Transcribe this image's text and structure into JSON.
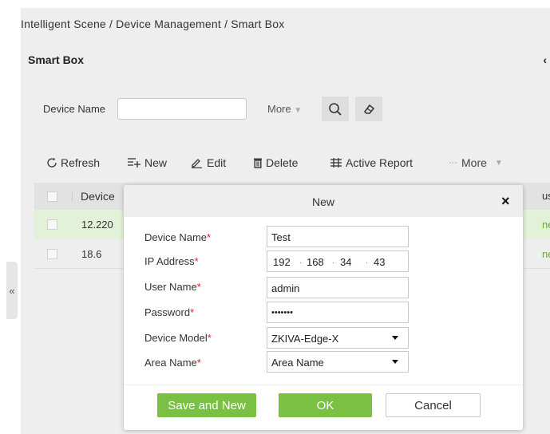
{
  "breadcrumb": "Intelligent Scene / Device Management / Smart Box",
  "panel": {
    "title": "Smart Box",
    "collapse_glyph": "‹"
  },
  "side_tab_glyph": "«",
  "search": {
    "label": "Device Name",
    "value": "",
    "more_label": "More"
  },
  "toolbar": {
    "refresh": "Refresh",
    "new": "New",
    "edit": "Edit",
    "delete": "Delete",
    "active_report": "Active Report",
    "more": "More"
  },
  "grid": {
    "headers": {
      "device": "Device",
      "status": "us"
    },
    "rows": [
      {
        "device": "12.220",
        "status": "ne"
      },
      {
        "device": "18.6",
        "status": "ne"
      }
    ]
  },
  "dialog": {
    "title": "New",
    "close_glyph": "×",
    "fields": {
      "device_name": {
        "label": "Device Name",
        "value": "Test"
      },
      "ip_address": {
        "label": "IP Address",
        "segments": [
          "192",
          "168",
          "34",
          "43"
        ]
      },
      "user_name": {
        "label": "User Name",
        "value": "admin"
      },
      "password": {
        "label": "Password",
        "value": "•••••••"
      },
      "device_model": {
        "label": "Device Model",
        "value": "ZKIVA-Edge-X"
      },
      "area_name": {
        "label": "Area Name",
        "value": "Area Name"
      }
    },
    "required_mark": "*",
    "buttons": {
      "save_new": "Save and New",
      "ok": "OK",
      "cancel": "Cancel"
    }
  },
  "colors": {
    "accent_green": "#7ac143",
    "required_red": "#e02020",
    "selected_row": "#e3f1d9"
  }
}
